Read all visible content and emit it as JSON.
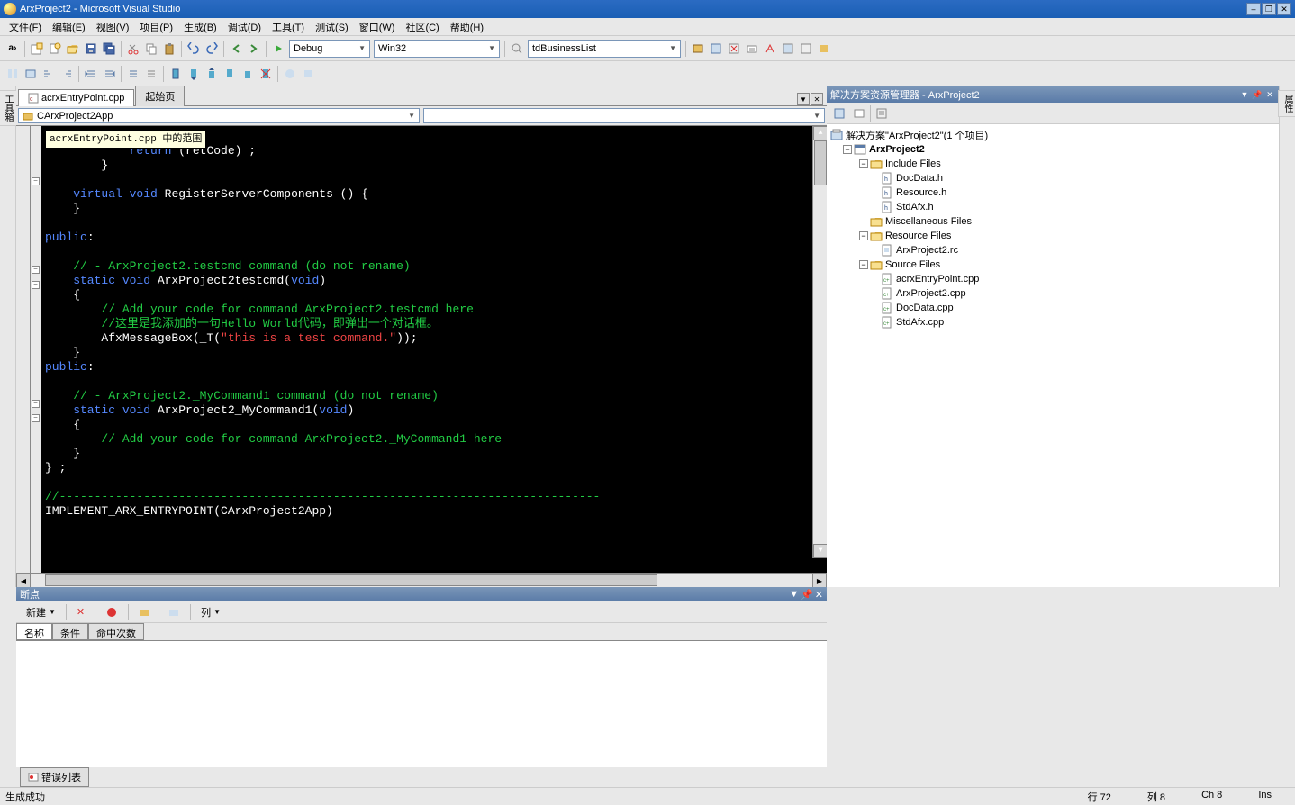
{
  "title": "ArxProject2 - Microsoft Visual Studio",
  "menus": [
    "文件(F)",
    "编辑(E)",
    "视图(V)",
    "项目(P)",
    "生成(B)",
    "调试(D)",
    "工具(T)",
    "测试(S)",
    "窗口(W)",
    "社区(C)",
    "帮助(H)"
  ],
  "toolbar": {
    "config": "Debug",
    "platform": "Win32",
    "find": "tdBusinessList"
  },
  "tabs": {
    "active": "acrxEntryPoint.cpp",
    "inactive": "起始页"
  },
  "classSelector": "CArxProject2App",
  "tooltip": "acrxEntryPoint.cpp 中的范围",
  "code": {
    "l1a": "            return",
    "l1b": " (retCode) ;",
    "l2": "        }",
    "l3": "",
    "l4a": "    virtual",
    "l4b": " void",
    "l4c": " RegisterServerComponents () {",
    "l5": "    }",
    "l6": "",
    "l7a": "public",
    "l7b": ":",
    "l8": "",
    "l9": "    // - ArxProject2.testcmd command (do not rename)",
    "l10a": "    static",
    "l10b": " void",
    "l10c": " ArxProject2testcmd(",
    "l10d": "void",
    "l10e": ")",
    "l11": "    {",
    "l12": "        // Add your code for command ArxProject2.testcmd here",
    "l13": "        //这里是我添加的一句Hello World代码，即弹出一个对话框。",
    "l14a": "        AfxMessageBox(_T(",
    "l14b": "\"this is a test command.\"",
    "l14c": "));",
    "l15": "    }",
    "l16a": "public",
    "l16b": ":",
    "l17": "",
    "l18": "    // - ArxProject2._MyCommand1 command (do not rename)",
    "l19a": "    static",
    "l19b": " void",
    "l19c": " ArxProject2_MyCommand1(",
    "l19d": "void",
    "l19e": ")",
    "l20": "    {",
    "l21": "        // Add your code for command ArxProject2._MyCommand1 here",
    "l22": "    }",
    "l23": "} ;",
    "l24": "",
    "l25": "//-----------------------------------------------------------------------------",
    "l26": "IMPLEMENT_ARX_ENTRYPOINT(CArxProject2App)"
  },
  "solutionExplorer": {
    "title": "解决方案资源管理器 - ArxProject2",
    "solution": "解决方案\"ArxProject2\"(1 个项目)",
    "project": "ArxProject2",
    "folders": {
      "include": "Include Files",
      "include_items": [
        "DocData.h",
        "Resource.h",
        "StdAfx.h"
      ],
      "misc": "Miscellaneous Files",
      "resource": "Resource Files",
      "resource_items": [
        "ArxProject2.rc"
      ],
      "source": "Source Files",
      "source_items": [
        "acrxEntryPoint.cpp",
        "ArxProject2.cpp",
        "DocData.cpp",
        "StdAfx.cpp"
      ]
    }
  },
  "leftDock": [
    "工具箱"
  ],
  "rightDock": [
    "属性"
  ],
  "breakpoints": {
    "title": "断点",
    "newBtn": "新建",
    "colBtn": "列",
    "tabs": [
      "名称",
      "条件",
      "命中次数"
    ]
  },
  "errorList": "错误列表",
  "status": {
    "msg": "生成成功",
    "line": "行 72",
    "col": "列 8",
    "ch": "Ch 8",
    "ins": "Ins"
  }
}
